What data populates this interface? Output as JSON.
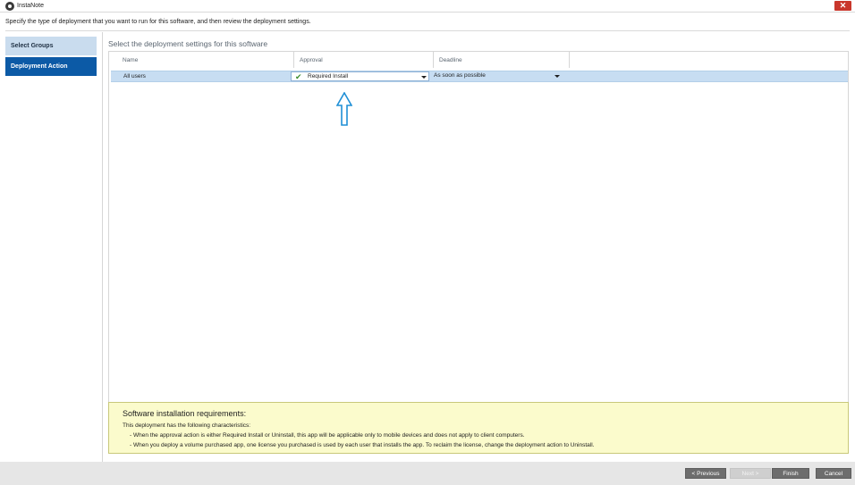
{
  "window": {
    "title": "InstaNote",
    "close_label": "✕"
  },
  "instruction": "Specify the type of deployment that you want to run for this software, and then review the deployment settings.",
  "nav": {
    "items": [
      {
        "label": "Select Groups"
      },
      {
        "label": "Deployment Action"
      }
    ]
  },
  "main": {
    "heading": "Select the deployment settings for this software",
    "columns": [
      "Name",
      "Approval",
      "Deadline"
    ],
    "row": {
      "name": "All users",
      "approval": "Required Install",
      "deadline": "As soon as possible"
    }
  },
  "requirements": {
    "title": "Software installation requirements:",
    "intro": "This deployment has the following characteristics:",
    "bullets": [
      "- When the approval action is either Required Install or Uninstall, this app will be applicable only to mobile devices and does not apply to client computers.",
      "- When you deploy a volume purchased app, one license you purchased is used by each user that installs the app. To reclaim the license, change the deployment action to Uninstall."
    ]
  },
  "footer": {
    "previous": "< Previous",
    "next": "Next >",
    "finish": "Finish",
    "cancel": "Cancel"
  },
  "icons": {
    "app": "app-logo-icon",
    "close": "close-icon",
    "check": "check-icon",
    "dropdown": "chevron-down-icon",
    "pointer": "up-arrow-icon"
  },
  "colors": {
    "nav_selected": "#0c5aa6",
    "nav_unselected": "#c9dcee",
    "row_selected": "#c7ddf2",
    "requirements_bg": "#fbfbcc",
    "close_red": "#c9372c",
    "check_green": "#3c8c2c",
    "pointer_arrow": "#1f8fd6"
  }
}
